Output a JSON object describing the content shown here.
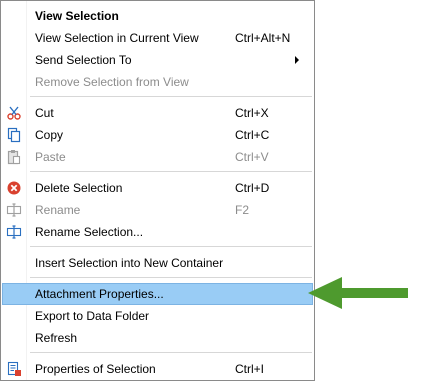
{
  "menu": {
    "items": [
      {
        "label": "View Selection",
        "shortcut": "",
        "icon": ""
      },
      {
        "label": "View Selection in Current View",
        "shortcut": "Ctrl+Alt+N",
        "icon": ""
      },
      {
        "label": "Send Selection To",
        "shortcut": "",
        "icon": "submenu-arrow"
      },
      {
        "label": "Remove Selection from View",
        "shortcut": "",
        "icon": ""
      },
      {
        "label": "Cut",
        "shortcut": "Ctrl+X",
        "icon": "scissors-icon"
      },
      {
        "label": "Copy",
        "shortcut": "Ctrl+C",
        "icon": "copy-icon"
      },
      {
        "label": "Paste",
        "shortcut": "Ctrl+V",
        "icon": "paste-icon"
      },
      {
        "label": "Delete Selection",
        "shortcut": "Ctrl+D",
        "icon": "delete-icon"
      },
      {
        "label": "Rename",
        "shortcut": "F2",
        "icon": "rename-icon"
      },
      {
        "label": "Rename Selection...",
        "shortcut": "",
        "icon": "rename-selection-icon"
      },
      {
        "label": "Insert Selection into New Container",
        "shortcut": "",
        "icon": ""
      },
      {
        "label": "Attachment Properties...",
        "shortcut": "",
        "icon": ""
      },
      {
        "label": "Export to Data Folder",
        "shortcut": "",
        "icon": ""
      },
      {
        "label": "Refresh",
        "shortcut": "",
        "icon": ""
      },
      {
        "label": "Properties of Selection",
        "shortcut": "Ctrl+I",
        "icon": "properties-icon"
      }
    ]
  },
  "colors": {
    "highlight": "#99ccf5",
    "pointer_arrow": "#4e9a2e",
    "delete_icon": "#d9412f",
    "icon_blue": "#2a6fc0",
    "disabled_text": "#8c8c8c"
  }
}
